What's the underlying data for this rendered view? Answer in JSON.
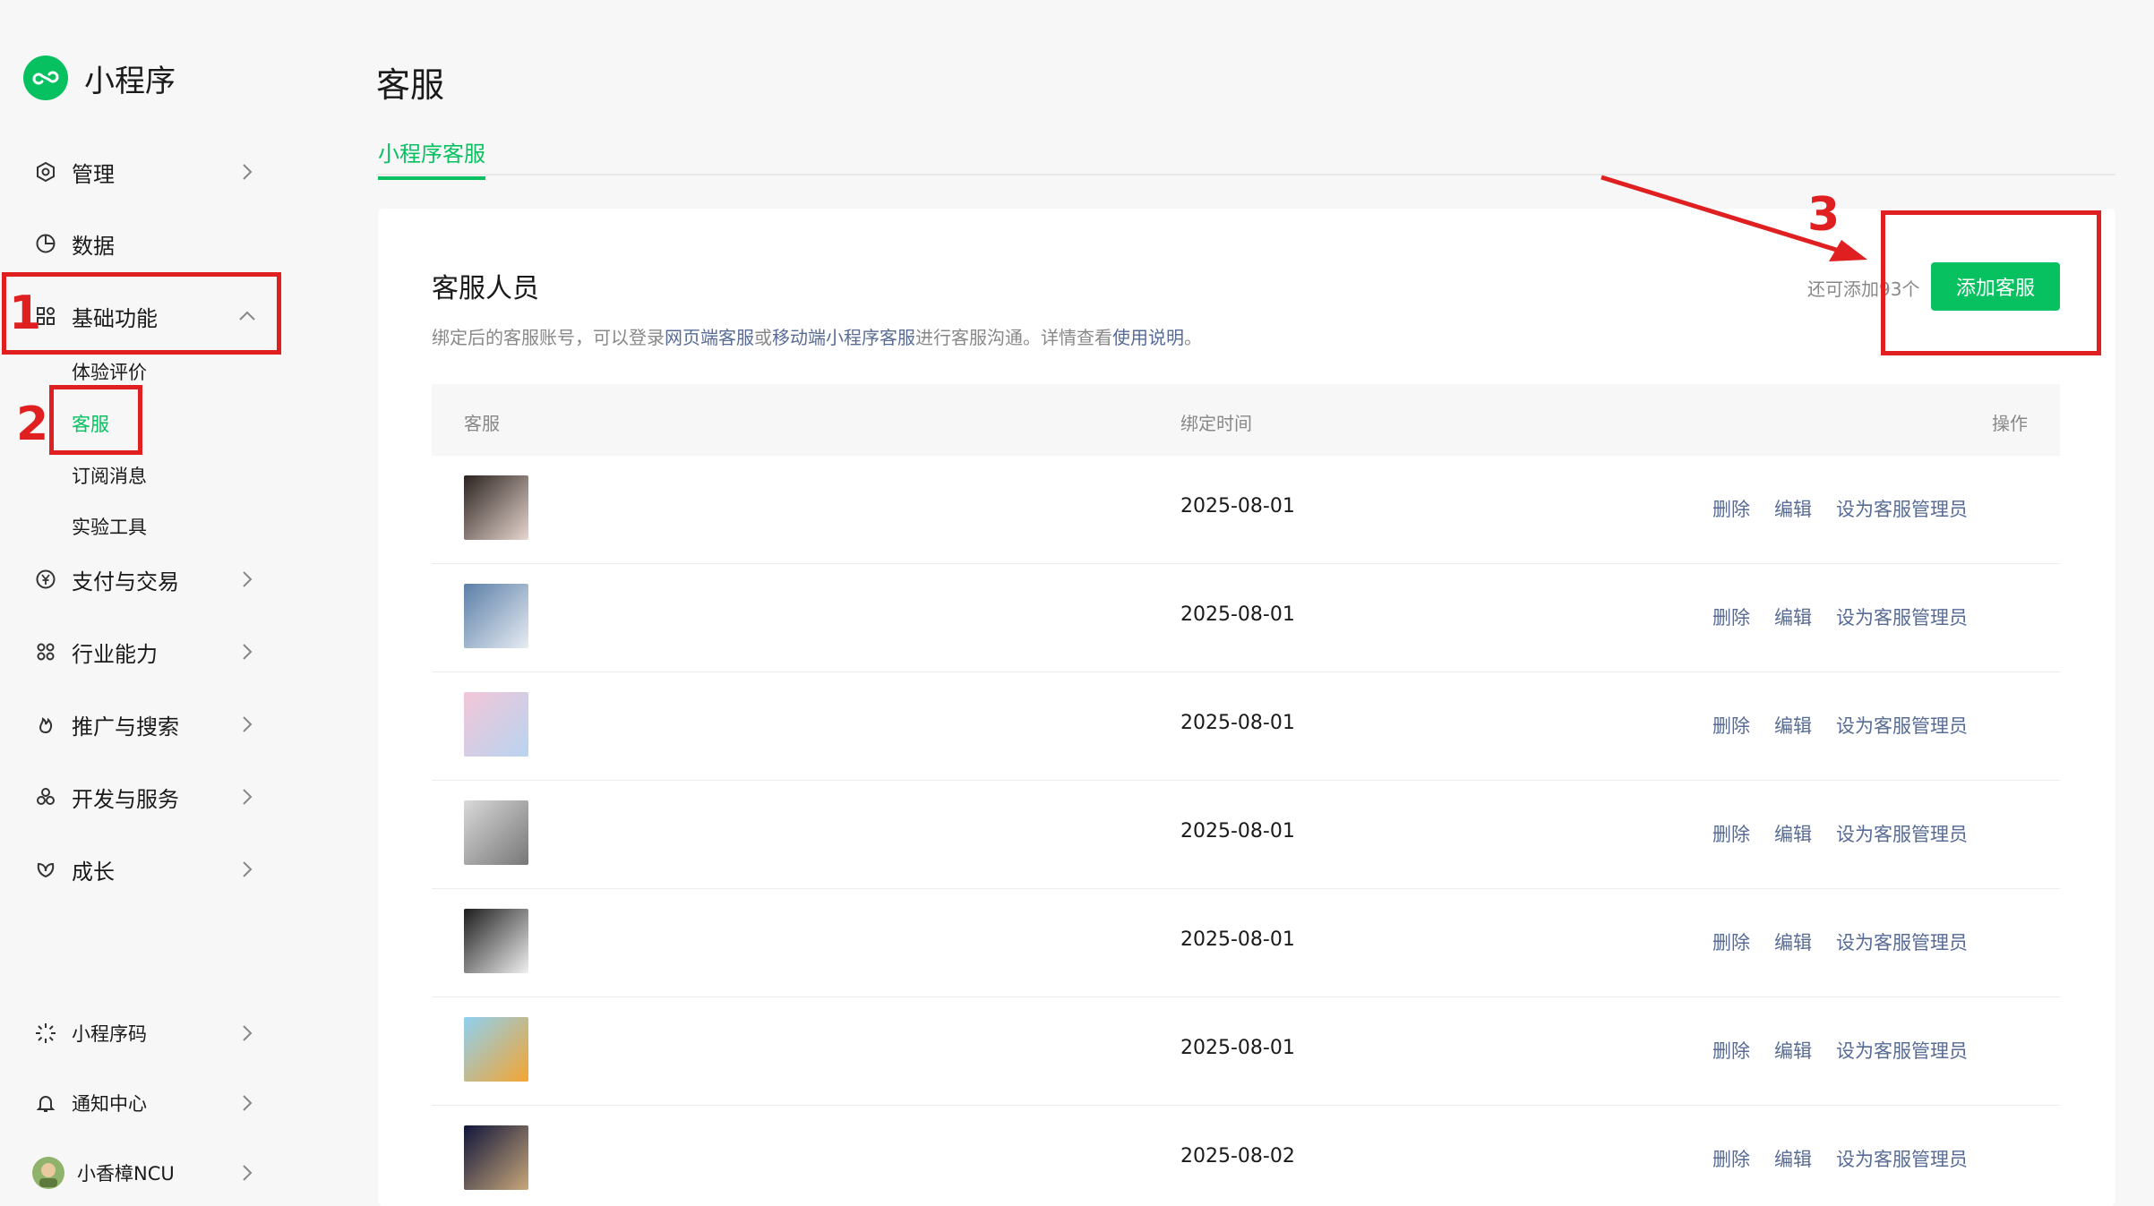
{
  "app": {
    "title": "小程序"
  },
  "sidebar": {
    "items": [
      {
        "label": "管理",
        "icon": "hexagon-icon"
      },
      {
        "label": "数据",
        "icon": "pie-chart-icon"
      },
      {
        "label": "基础功能",
        "icon": "grid-icon",
        "expanded": true,
        "children": [
          "体验评价",
          "客服",
          "订阅消息",
          "实验工具"
        ],
        "active_child": "客服"
      },
      {
        "label": "支付与交易",
        "icon": "yen-icon"
      },
      {
        "label": "行业能力",
        "icon": "industry-icon"
      },
      {
        "label": "推广与搜索",
        "icon": "flame-icon"
      },
      {
        "label": "开发与服务",
        "icon": "cluster-icon"
      },
      {
        "label": "成长",
        "icon": "leaf-icon"
      }
    ],
    "bottom": [
      {
        "label": "小程序码",
        "icon": "sun-burst-icon"
      },
      {
        "label": "通知中心",
        "icon": "bell-icon"
      },
      {
        "label": "小香樟NCU",
        "icon": "account-avatar"
      }
    ]
  },
  "page": {
    "title": "客服",
    "tab": "小程序客服",
    "section_title": "客服人员",
    "desc": {
      "part1": "绑定后的客服账号，可以登录",
      "link1": "网页端客服",
      "part2": "或",
      "link2": "移动端小程序客服",
      "part3": "进行客服沟通。详情查看",
      "link3": "使用说明",
      "part4": "。"
    },
    "remain": "还可添加93个",
    "add_button": "添加客服",
    "columns": [
      "客服",
      "绑定时间",
      "操作"
    ],
    "rows": [
      {
        "date": "2025-08-01"
      },
      {
        "date": "2025-08-01"
      },
      {
        "date": "2025-08-01"
      },
      {
        "date": "2025-08-01"
      },
      {
        "date": "2025-08-01"
      },
      {
        "date": "2025-08-01"
      },
      {
        "date": "2025-08-02"
      }
    ],
    "actions": {
      "delete": "删除",
      "edit": "编辑",
      "set_admin": "设为客服管理员"
    }
  },
  "annotations": {
    "n1": "1",
    "n2": "2",
    "n3": "3",
    "color": "#e02020"
  },
  "colors": {
    "brand": "#07c160",
    "link": "#576b95"
  }
}
